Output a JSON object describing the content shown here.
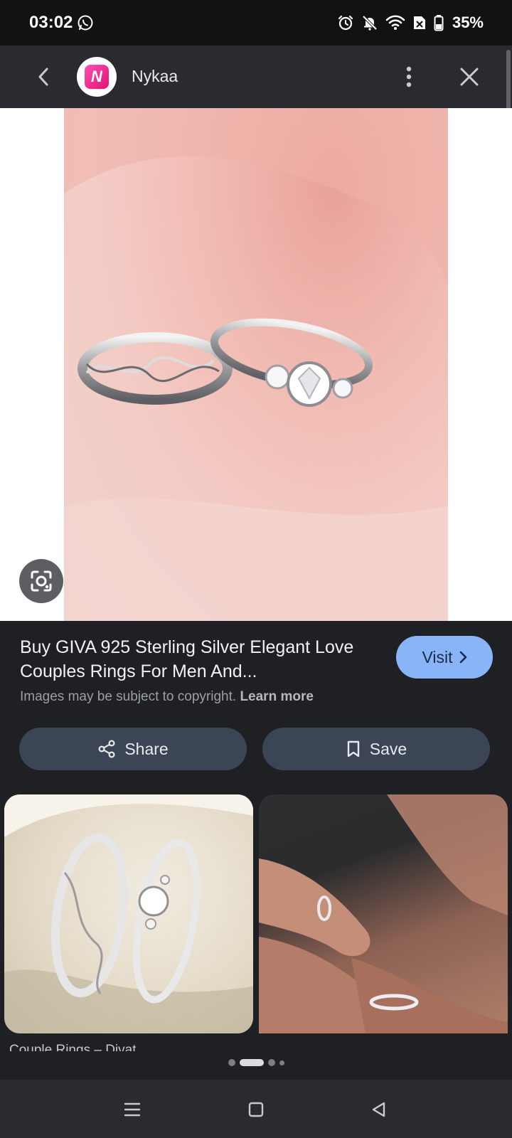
{
  "status_bar": {
    "time": "03:02",
    "battery": "35%",
    "icons": [
      "whatsapp-icon",
      "alarm-icon",
      "bell-off-icon",
      "wifi-icon",
      "no-sim-icon",
      "battery-icon"
    ]
  },
  "app_bar": {
    "title": "Nykaa",
    "logo_letter": "N",
    "back_icon": "chevron-left-icon",
    "more_icon": "more-vert-icon",
    "close_icon": "close-icon"
  },
  "main_image": {
    "alt": "silver couple rings on pink fabric"
  },
  "info": {
    "title": "Buy GIVA 925 Sterling Silver Elegant Love Couples Rings For Men And...",
    "copyright_text": "Images may be subject to copyright.",
    "learn_more": "Learn more",
    "visit_label": "Visit",
    "share_label": "Share",
    "save_label": "Save"
  },
  "related": {
    "caption_1": "Couple Rings – Divat"
  },
  "colors": {
    "background": "#1f2023",
    "app_bar": "#2a2b30",
    "visit_button": "#8ab4f8",
    "action_button": "#3c4555",
    "brand_pink": "#e3126f"
  }
}
